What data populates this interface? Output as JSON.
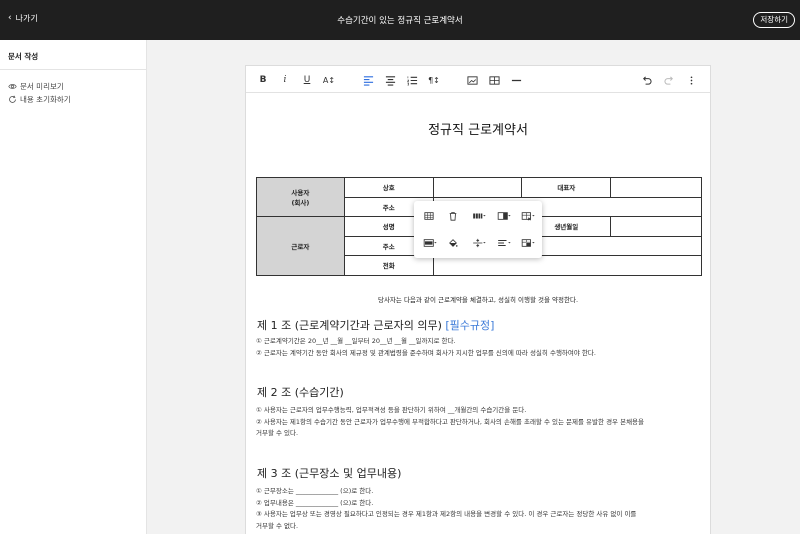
{
  "topbar": {
    "back_label": "나가기",
    "title": "수습기간이 있는 정규직 근로계약서",
    "save_label": "저장하기"
  },
  "sidebar": {
    "heading": "문서 작성",
    "items": [
      {
        "label": "문서 미리보기",
        "icon": "eye-icon"
      },
      {
        "label": "내용 초기화하기",
        "icon": "refresh-icon"
      }
    ]
  },
  "toolbar": {
    "buttons": [
      "bold",
      "italic",
      "underline",
      "text-size",
      "align-left",
      "align-center",
      "numbered-list",
      "paragraph",
      "image",
      "table",
      "horizontal-rule",
      "undo",
      "redo",
      "more"
    ],
    "bold_label": "B",
    "italic_label": "i",
    "underline_label": "U",
    "textsize_label": "A↕",
    "paragraph_label": "¶↕"
  },
  "document": {
    "title": "정규직 근로계약서",
    "table": {
      "employer": "사용자\n(회사)",
      "company_name": "상호",
      "representative": "대표자",
      "address": "주소",
      "worker": "근로자",
      "name": "성명",
      "birth": "생년월일",
      "worker_address": "주소",
      "phone": "전화"
    },
    "agreement": "당사자는 다음과 같이 근로계약을 체결하고, 성실히 이행할 것을 약정한다.",
    "articles": [
      {
        "heading": "제 1 조 (근로계약기간과 근로자의 의무)",
        "tag": "[필수규정]",
        "lines": [
          "① 근로계약기간은 20__년 __월 __일부터 20__년 __월 __일까지로 한다.",
          "② 근로자는 계약기간 동안 회사의 제규정 및 관계법령을 준수하며 회사가 지시한 업무를 신의에 따라 성실히 수행하여야 한다."
        ]
      },
      {
        "heading": "제 2 조 (수습기간)",
        "tag": "",
        "lines": [
          "① 사용자는 근로자의 업무수행능력, 업무적격성 등을 판단하기 위하여 __개월간의 수습기간을 둔다.",
          "② 사용자는 제1항의 수습기간 동안 근로자가 업무수행에 부적합하다고 판단하거나, 회사의 손해를 초래할 수 있는 문제를 유발한 경우 본채용을",
          "거부할 수 있다."
        ]
      },
      {
        "heading": "제 3 조 (근무장소 및 업무내용)",
        "tag": "",
        "lines": [
          "① 근무장소는 _____________ (으)로 한다.",
          "② 업무내용은 _____________ (으)로 한다.",
          "③  사용자는 업무상 또는 경영상 필요하다고 인정되는 경우 제1항과 제2항의 내용을 변경할 수 있다. 이 경우 근로자는 정당한 사유 없이 이를",
          "거부할 수 없다."
        ]
      }
    ]
  },
  "table_menu": {
    "items": [
      "table-icon",
      "trash-icon",
      "insert-row-icon",
      "insert-column-icon",
      "delete-column-icon",
      "merge-cells-icon",
      "fill-color-icon",
      "vertical-align-icon",
      "text-align-icon",
      "cell-options-icon"
    ]
  }
}
